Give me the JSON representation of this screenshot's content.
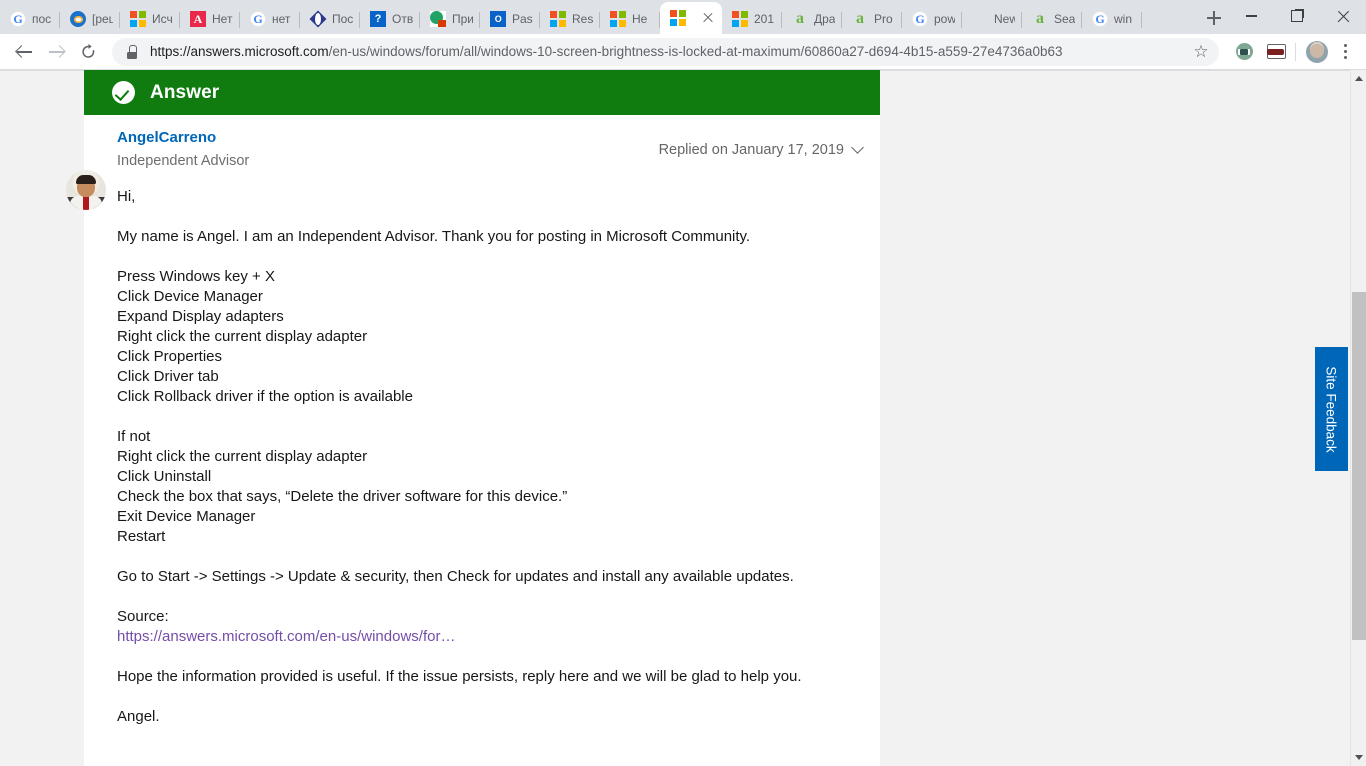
{
  "browser": {
    "tabs": [
      {
        "label": "пос",
        "favicon": "google-icon"
      },
      {
        "label": "[рец",
        "favicon": "opera-icon"
      },
      {
        "label": "Исч",
        "favicon": "microsoft-icon"
      },
      {
        "label": "Нет",
        "favicon": "red-a-icon"
      },
      {
        "label": "нет",
        "favicon": "google-icon"
      },
      {
        "label": "Пос",
        "favicon": "diamond-icon"
      },
      {
        "label": "Отв",
        "favicon": "question-icon"
      },
      {
        "label": "При",
        "favicon": "green-circle-icon"
      },
      {
        "label": "Past",
        "favicon": "outlook-icon"
      },
      {
        "label": "Res",
        "favicon": "microsoft-icon"
      },
      {
        "label": "Не",
        "favicon": "microsoft-icon"
      },
      {
        "label": "",
        "favicon": "microsoft-icon",
        "active": true
      },
      {
        "label": "201",
        "favicon": "microsoft-icon"
      },
      {
        "label": "Дра",
        "favicon": "green-a-icon"
      },
      {
        "label": "Pro",
        "favicon": "green-a-icon"
      },
      {
        "label": "pow",
        "favicon": "google-icon"
      },
      {
        "label": "New Tab",
        "favicon": "blank-icon"
      },
      {
        "label": "Sea",
        "favicon": "green-a-icon"
      },
      {
        "label": "win",
        "favicon": "google-icon"
      }
    ],
    "new_tab_label": "+",
    "window_controls": {
      "minimize": "minimize-icon",
      "maximize": "maximize-icon",
      "close": "close-icon"
    },
    "toolbar": {
      "back": "back-arrow-icon",
      "forward": "forward-arrow-icon",
      "reload": "reload-icon",
      "lock": "lock-icon",
      "url_scheme": "https://",
      "url_domain": "answers.microsoft.com",
      "url_path": "/en-us/windows/forum/all/windows-10-screen-brightness-is-locked-at-maximum/60860a27-d694-4b15-a559-27e4736a0b63",
      "bookmark": "star-icon",
      "extension_1": "adblock-icon",
      "extension_2": "mask-extension-icon",
      "profile": "avatar",
      "menu": "kebab-menu-icon"
    }
  },
  "answer": {
    "banner_label": "Answer",
    "banner_icon": "check-circle-icon",
    "banner_color": "#107c10",
    "author_name": "AngelCarreno",
    "author_role": "Independent Advisor",
    "replied_on": "Replied on January 17, 2019",
    "avatar": "author-avatar",
    "body": [
      {
        "type": "p",
        "lines": [
          "Hi,"
        ]
      },
      {
        "type": "p",
        "lines": [
          "My name is Angel. I am an Independent Advisor. Thank you for posting in Microsoft Community."
        ]
      },
      {
        "type": "p",
        "lines": [
          "Press Windows key + X",
          "Click Device Manager",
          "Expand Display adapters",
          "Right click the current display adapter",
          "Click Properties",
          "Click Driver tab",
          "Click Rollback driver if the option is available"
        ]
      },
      {
        "type": "p",
        "lines": [
          "If not",
          "Right click the current display adapter",
          "Click Uninstall",
          "Check the box that says, “Delete the driver software for this device.”",
          "Exit Device Manager",
          "Restart"
        ]
      },
      {
        "type": "p",
        "lines": [
          "Go to Start -> Settings -> Update & security, then Check for updates and install any available updates."
        ]
      },
      {
        "type": "p",
        "lines": [
          "Source:"
        ],
        "link": "https://answers.microsoft.com/en-us/windows/for…"
      },
      {
        "type": "p",
        "lines": [
          "Hope the information provided is useful. If the issue persists, reply here and we will be glad to help you."
        ]
      },
      {
        "type": "p",
        "lines": [
          "Angel."
        ]
      }
    ]
  },
  "site_feedback": {
    "label": "Site Feedback",
    "color": "#0067b8"
  }
}
